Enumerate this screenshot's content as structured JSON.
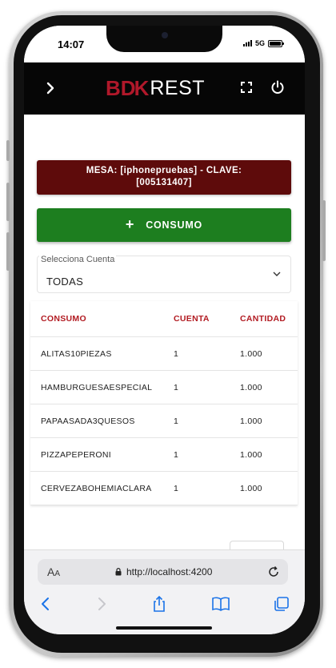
{
  "status": {
    "time": "14:07",
    "network": "5G"
  },
  "header": {
    "logo_brand_a": "B",
    "logo_brand_b": "D",
    "logo_brand_c": "K",
    "logo_brand_rest": "REST",
    "icons": [
      "chevron-right-icon",
      "fullscreen-icon",
      "power-icon"
    ]
  },
  "mesa": {
    "line1": "MESA: [iphonepruebas] - CLAVE:",
    "line2": "[005131407]"
  },
  "consumo_button": {
    "icon": "plus",
    "label": "CONSUMO"
  },
  "cuenta_select": {
    "label": "Selecciona Cuenta",
    "value": "TODAS"
  },
  "table": {
    "headers": [
      "CONSUMO",
      "CUENTA",
      "CANTIDAD"
    ],
    "rows": [
      [
        "ALITAS10PIEZAS",
        "1",
        "1.000"
      ],
      [
        "HAMBURGUESAESPECIAL",
        "1",
        "1.000"
      ],
      [
        "PAPAASADA3QUESOS",
        "1",
        "1.000"
      ],
      [
        "PIZZAPEPERONI",
        "1",
        "1.000"
      ],
      [
        "CERVEZABOHEMIACLARA",
        "1",
        "1.000"
      ]
    ]
  },
  "browser": {
    "aa_label": "AA",
    "url": "http://localhost:4200"
  },
  "colors": {
    "header_bg": "#060606",
    "brand_red": "#b0182a",
    "mesa_bg": "#5e0b0b",
    "consumo_green": "#1d7e1f",
    "table_header_red": "#b21b22",
    "safari_blue": "#1a73e8"
  }
}
